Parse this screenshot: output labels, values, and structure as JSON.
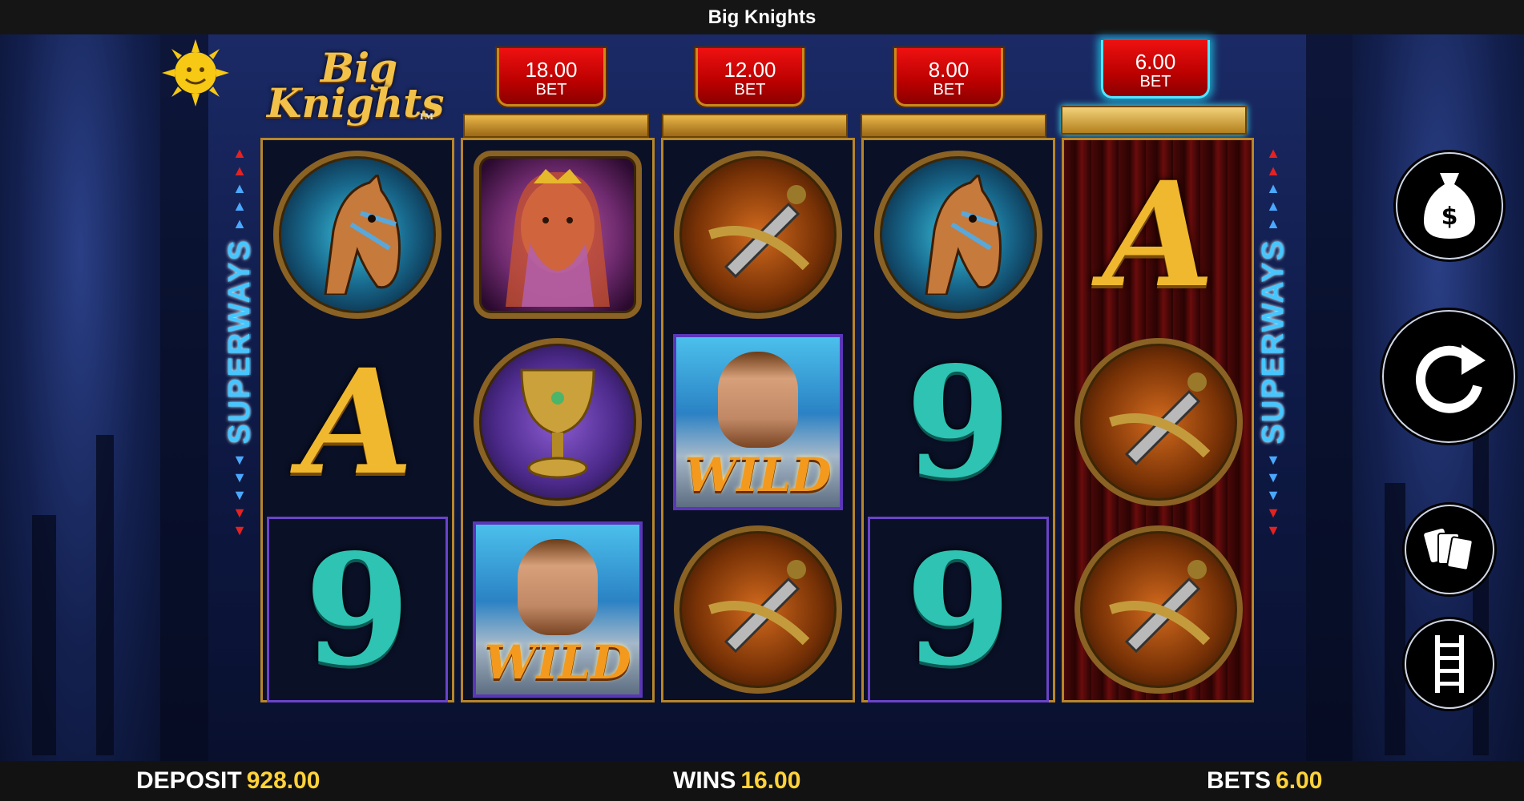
{
  "window": {
    "title": "Big Knights"
  },
  "logo": {
    "line1": "Big",
    "line2": "Knights",
    "tm": "TM"
  },
  "bets": [
    {
      "value": "18.00",
      "label": "BET",
      "active": false
    },
    {
      "value": "12.00",
      "label": "BET",
      "active": false
    },
    {
      "value": "8.00",
      "label": "BET",
      "active": false
    },
    {
      "value": "6.00",
      "label": "BET",
      "active": true
    }
  ],
  "side_label": "SUPERWAYS",
  "reels": [
    [
      "horse",
      "A",
      "9"
    ],
    [
      "lady",
      "goblet",
      "WILD"
    ],
    [
      "sword",
      "WILD",
      "sword"
    ],
    [
      "horse",
      "9",
      "9"
    ],
    [
      "A",
      "sword",
      "sword"
    ]
  ],
  "symbols": {
    "letter_a": "A",
    "nine": "9",
    "wild": "WILD"
  },
  "controls": {
    "cashout_icon": "money-bag-icon",
    "spin_icon": "spin-icon",
    "gamble_icon": "cards-icon",
    "ladder_icon": "ladder-icon"
  },
  "footer": {
    "deposit_label": "DEPOSIT",
    "deposit_value": "928.00",
    "wins_label": "WINS",
    "wins_value": "16.00",
    "bets_label": "BETS",
    "bets_value": "6.00"
  },
  "colors": {
    "accent": "#ffd23a",
    "banner": "#d10f0f",
    "frame": "#b7862a",
    "superways": "#46c6ff"
  }
}
